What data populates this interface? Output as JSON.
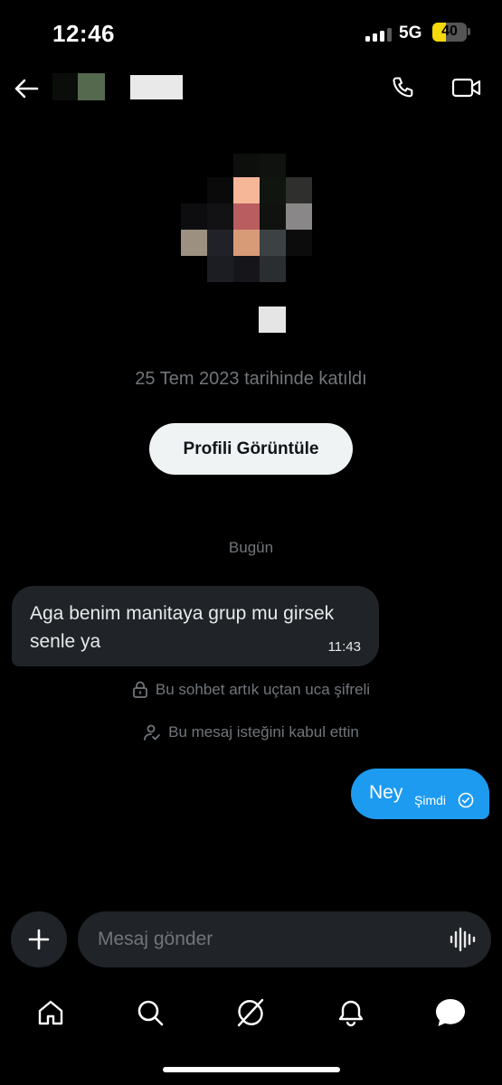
{
  "status_bar": {
    "time": "12:46",
    "network": "5G",
    "battery_level": "40",
    "battery_fraction": 0.4,
    "battery_color": "#f5d90a"
  },
  "header": {
    "back_icon": "arrow-left-icon",
    "call_icon": "phone-icon",
    "video_icon": "video-camera-icon"
  },
  "profile": {
    "joined_text": "25 Tem 2023 tarihinde katıldı",
    "view_profile_label": "Profili Görüntüle"
  },
  "conversation": {
    "day_label": "Bugün",
    "incoming": {
      "text": "Aga benim manitaya grup mu girsek senle ya",
      "time": "11:43"
    },
    "system_messages": [
      {
        "icon": "lock-icon",
        "text": "Bu sohbet artık uçtan uca şifreli"
      },
      {
        "icon": "person-check-icon",
        "text": "Bu mesaj isteğini kabul ettin"
      }
    ],
    "outgoing": {
      "text": "Ney",
      "time": "Şimdi",
      "status_icon": "sent-check-icon"
    }
  },
  "composer": {
    "placeholder": "Mesaj gönder",
    "add_icon": "plus-icon",
    "voice_icon": "voice-wave-icon"
  },
  "tabbar": {
    "items": [
      "home-icon",
      "search-icon",
      "grok-icon",
      "notifications-bell-icon",
      "messages-icon"
    ],
    "active": "messages-icon"
  },
  "colors": {
    "background": "#000000",
    "accent": "#1d9bf0",
    "bubble_incoming": "#202327",
    "muted_text": "#71767b"
  }
}
